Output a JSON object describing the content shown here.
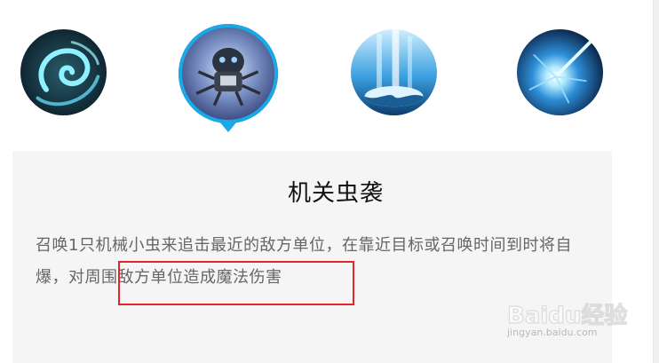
{
  "skills": [
    {
      "icon": "swirl-wind-icon",
      "selected": false
    },
    {
      "icon": "mechanical-bug-icon",
      "selected": true
    },
    {
      "icon": "yin-yang-light-icon",
      "selected": false
    },
    {
      "icon": "energy-burst-icon",
      "selected": false
    }
  ],
  "selected_skill": {
    "title": "机关虫袭",
    "description": "召唤1只机械小虫来追击最近的敌方单位，在靠近目标或召唤时间到时将自爆，对周围敌方单位造成魔法伤害"
  },
  "watermark": {
    "brand": "Baidu经验",
    "url": "jingyan.baidu.com"
  },
  "colors": {
    "accent": "#1aa8e6",
    "highlight_box": "#e0262d",
    "panel_bg": "#f5f5f5",
    "title_text": "#111111",
    "body_text": "#666666"
  }
}
